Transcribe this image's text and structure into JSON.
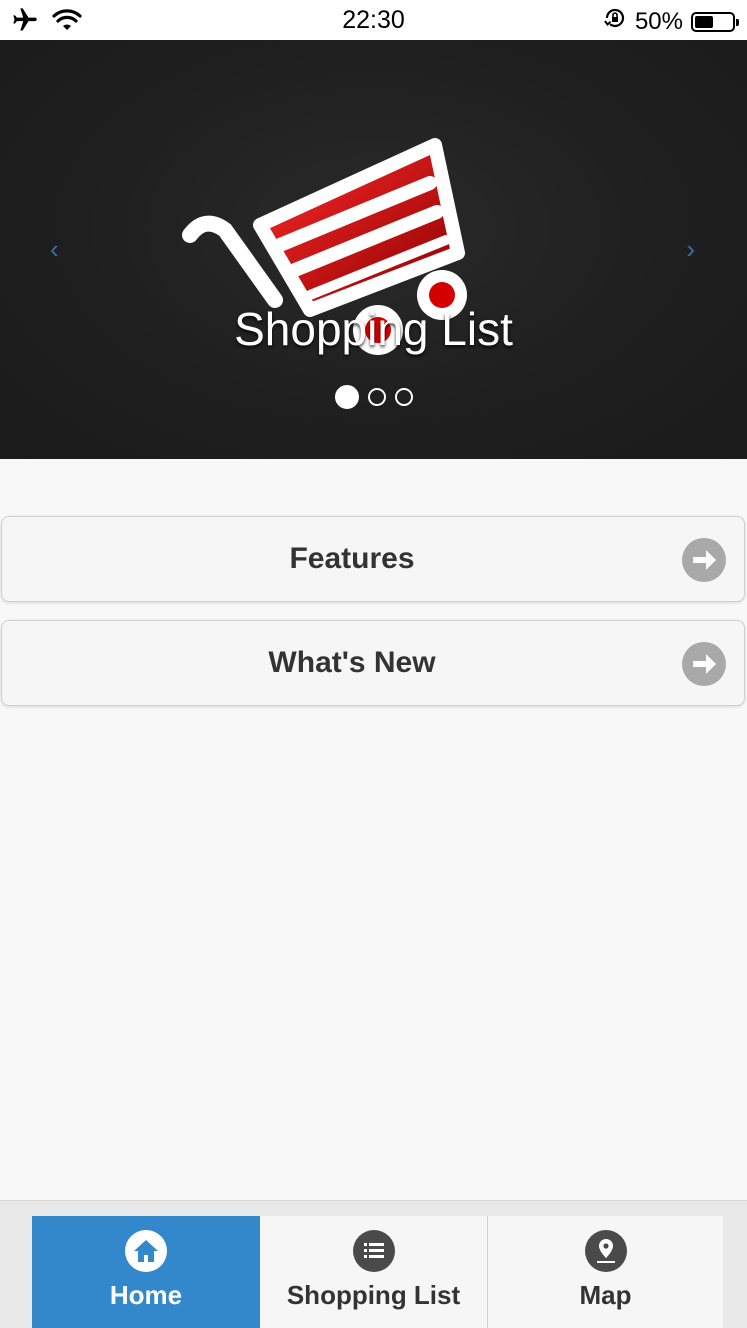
{
  "status_bar": {
    "time": "22:30",
    "battery_percent": "50%",
    "battery_level": 0.5,
    "icons": [
      "airplane-icon",
      "wifi-icon",
      "orientation-lock-icon",
      "battery-icon"
    ]
  },
  "carousel": {
    "caption": "Shopping List",
    "prev_symbol": "‹",
    "next_symbol": "›",
    "slide_count": 3,
    "active_slide": 0
  },
  "list": {
    "items": [
      {
        "label": "Features"
      },
      {
        "label": "What's New"
      }
    ]
  },
  "navbar": {
    "tabs": [
      {
        "label": "Home",
        "icon": "home-icon",
        "active": true
      },
      {
        "label": "Shopping List",
        "icon": "list-icon",
        "active": false
      },
      {
        "label": "Map",
        "icon": "location-pin-icon",
        "active": false
      }
    ]
  },
  "colors": {
    "accent": "#3388cc",
    "cart_red": "#cc0000",
    "arrow_gray": "#a9a9a9"
  }
}
